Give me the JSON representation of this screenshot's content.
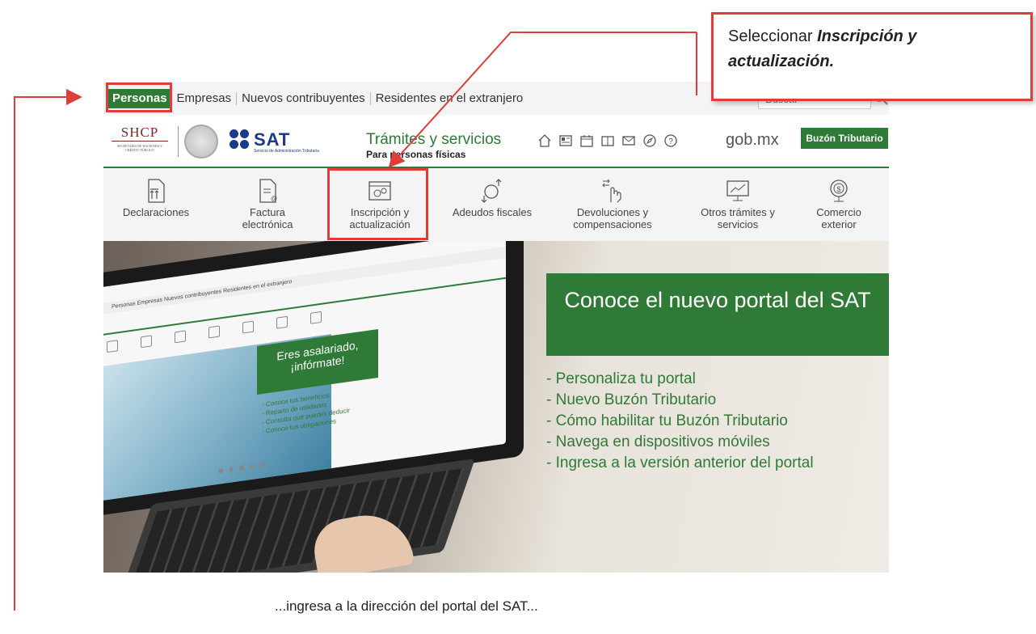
{
  "topnav": {
    "tabs": [
      "Personas",
      "Empresas",
      "Nuevos contribuyentes",
      "Residentes en el extranjero"
    ],
    "search_placeholder": "Buscar"
  },
  "header": {
    "shcp_logo": "SHCP",
    "shcp_sub": "SECRETARÍA DE HACIENDA Y CRÉDITO PÚBLICO",
    "sat_logo": "SAT",
    "sat_sub": "Servicio de Administración Tributaria",
    "title": "Trámites y servicios",
    "subtitle": "Para personas físicas",
    "icons": [
      "home-icon",
      "newspaper-icon",
      "calendar-icon",
      "book-icon",
      "mail-icon",
      "compass-icon",
      "help-icon"
    ],
    "gob": "gob.mx",
    "buzon": "Buzón Tributario"
  },
  "services": [
    {
      "label": "Declaraciones",
      "icon": "declaraciones-icon"
    },
    {
      "label": "Factura electrónica",
      "icon": "factura-icon"
    },
    {
      "label": "Inscripción y actualización",
      "icon": "inscripcion-icon"
    },
    {
      "label": "Adeudos fiscales",
      "icon": "adeudos-icon"
    },
    {
      "label": "Devoluciones y compensaciones",
      "icon": "devoluciones-icon"
    },
    {
      "label": "Otros trámites y servicios",
      "icon": "otros-icon"
    },
    {
      "label": "Comercio exterior",
      "icon": "comercio-icon"
    }
  ],
  "hero": {
    "headline": "Conoce el nuevo portal del SAT",
    "links": [
      "- Personaliza tu portal",
      "- Nuevo Buzón Tributario",
      "- Cómo habilitar tu Buzón Tributario",
      "- Navega en dispositivos móviles",
      "- Ingresa a la versión anterior del portal"
    ],
    "mini_screen": {
      "nav": "Personas   Empresas   Nuevos contribuyentes   Residentes en el extranjero",
      "box": "Eres asalariado, ¡infórmate!",
      "list": [
        "- Conoce tus beneficios",
        "- Reparto de utilidades",
        "- Consulta qué puedes deducir",
        "- Conoce tus obligaciones"
      ]
    }
  },
  "annotation": {
    "callout_prefix": "Seleccionar ",
    "callout_bold": "Inscripción y actualización.",
    "caption": "...ingresa a la dirección del portal del SAT..."
  },
  "colors": {
    "sat_green": "#2f7a36",
    "annotation_red": "#e23b3b",
    "sat_blue": "#1b3a8c"
  }
}
